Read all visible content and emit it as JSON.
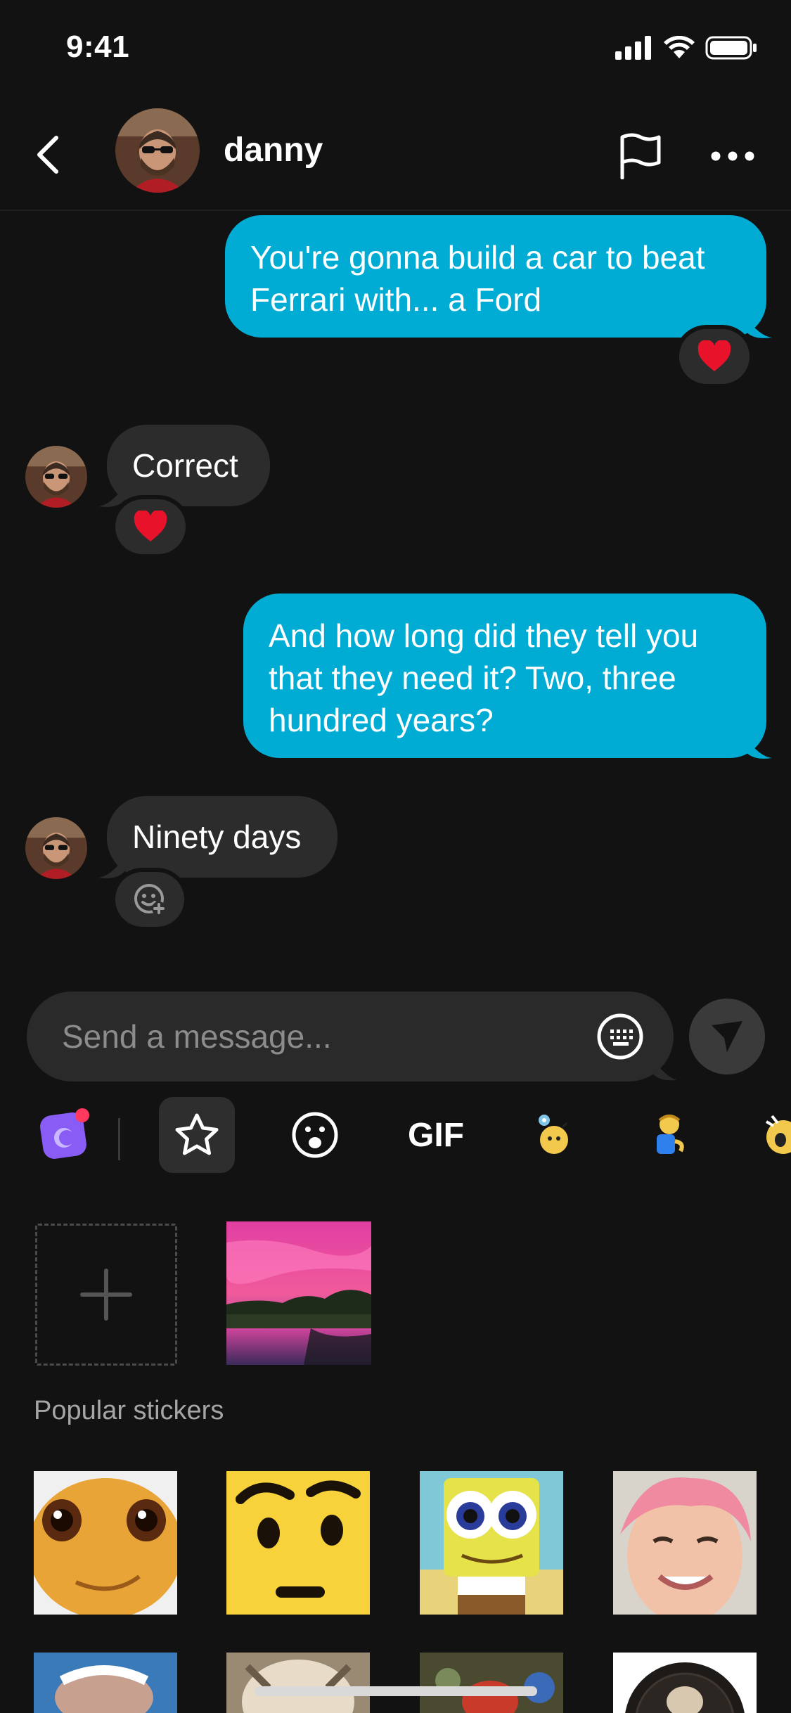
{
  "status_bar": {
    "time": "9:41"
  },
  "header": {
    "contact_name": "danny"
  },
  "messages": [
    {
      "direction": "outgoing",
      "text": "You're gonna build a car to beat Ferrari with... a Ford",
      "reaction": "heart"
    },
    {
      "direction": "incoming",
      "text": "Correct",
      "reaction": "heart"
    },
    {
      "direction": "outgoing",
      "text": "And how long did they tell you that they need it? Two, three hundred years?"
    },
    {
      "direction": "incoming",
      "text": "Ninety days",
      "reaction": "add-reaction"
    }
  ],
  "composer": {
    "placeholder": "Send a message..."
  },
  "sticker_tabs": [
    "avatar-sticker",
    "favorites",
    "emoji",
    "GIF",
    "sticker-pack-1",
    "sticker-pack-2",
    "sticker-pack-3"
  ],
  "gif_label": "GIF",
  "stickers": {
    "section_title": "Popular stickers"
  },
  "colors": {
    "background": "#121212",
    "outgoing_bubble": "#00acd3",
    "incoming_bubble": "#2c2c2c",
    "heart": "#e8132b"
  }
}
